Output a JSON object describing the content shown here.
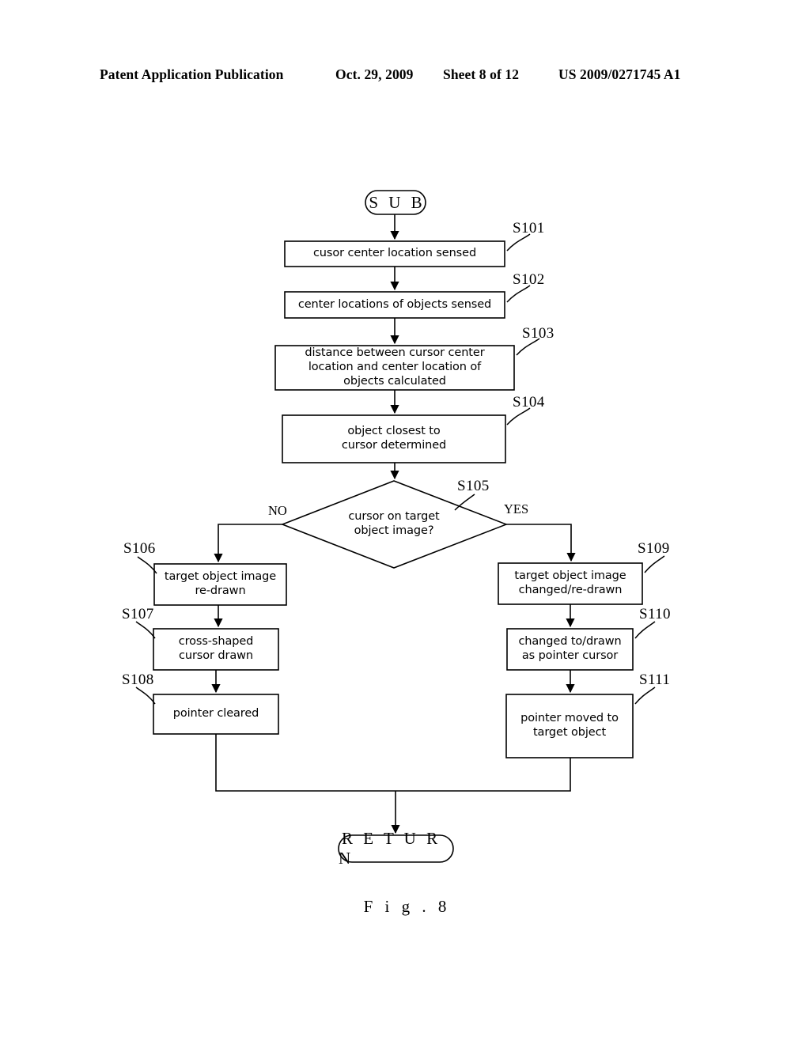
{
  "header": {
    "publication": "Patent Application Publication",
    "date": "Oct. 29, 2009",
    "sheet": "Sheet 8 of 12",
    "patent_number": "US 2009/0271745 A1"
  },
  "figure": {
    "caption": "F i g .  8",
    "type": "flowchart"
  },
  "flowchart": {
    "start": {
      "label": "S U B"
    },
    "end": {
      "label": "R E T U R N"
    },
    "branch_labels": {
      "no": "NO",
      "yes": "YES"
    },
    "steps": [
      {
        "id": "S101",
        "text": "cusor center location sensed",
        "lines": [
          "cusor center location sensed"
        ],
        "shape": "process"
      },
      {
        "id": "S102",
        "text": "center locations of objects sensed",
        "lines": [
          "center locations of objects sensed"
        ],
        "shape": "process"
      },
      {
        "id": "S103",
        "text": "distance between cursor center location and center location of objects calculated",
        "lines": [
          "distance between cursor center",
          "location and center location of",
          "objects calculated"
        ],
        "shape": "process"
      },
      {
        "id": "S104",
        "text": "object closest to cursor determined",
        "lines": [
          "object closest to",
          "cursor determined"
        ],
        "shape": "process"
      },
      {
        "id": "S105",
        "text": "cursor on target object image?",
        "lines": [
          "cursor on target",
          "object image?"
        ],
        "shape": "decision"
      },
      {
        "id": "S106",
        "text": "target object image re-drawn",
        "lines": [
          "target object image",
          "re-drawn"
        ],
        "shape": "process"
      },
      {
        "id": "S107",
        "text": "cross-shaped cursor drawn",
        "lines": [
          "cross-shaped",
          "cursor drawn"
        ],
        "shape": "process"
      },
      {
        "id": "S108",
        "text": "pointer cleared",
        "lines": [
          "pointer cleared"
        ],
        "shape": "process"
      },
      {
        "id": "S109",
        "text": "target object image changed/re-drawn",
        "lines": [
          "target object image",
          "changed/re-drawn"
        ],
        "shape": "process"
      },
      {
        "id": "S110",
        "text": "changed to/drawn as pointer cursor",
        "lines": [
          "changed to/drawn",
          "as pointer cursor"
        ],
        "shape": "process"
      },
      {
        "id": "S111",
        "text": "pointer moved to target object",
        "lines": [
          "pointer moved to",
          "target object"
        ],
        "shape": "process"
      }
    ],
    "colors": {
      "stroke": "#000000",
      "fill": "#ffffff",
      "text": "#000000"
    }
  }
}
